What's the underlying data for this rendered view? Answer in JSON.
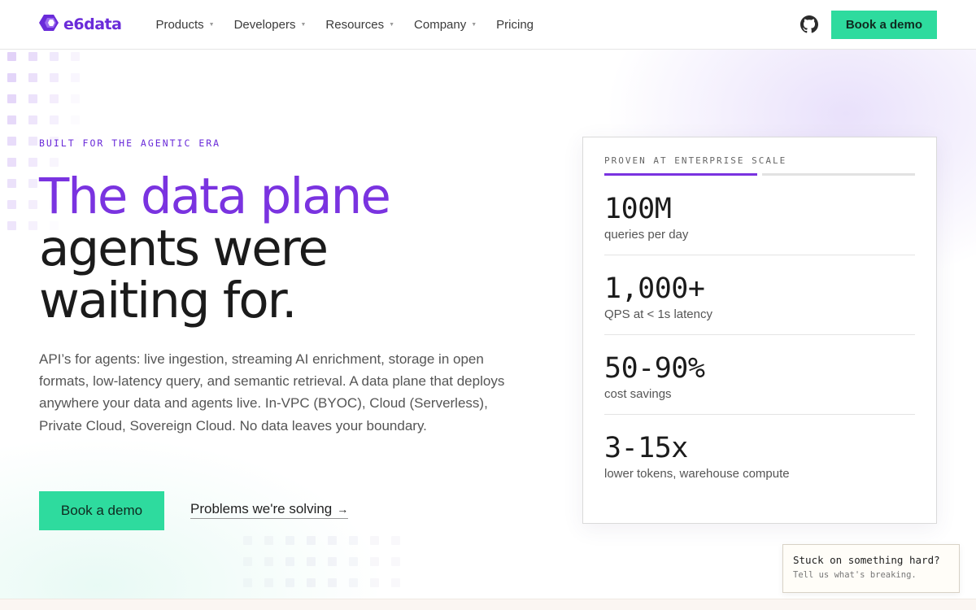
{
  "brand": {
    "name": "e6data",
    "accent": "#7a33e0",
    "cta_color": "#2edb9e"
  },
  "nav": {
    "items": [
      {
        "label": "Products",
        "has_dropdown": true
      },
      {
        "label": "Developers",
        "has_dropdown": true
      },
      {
        "label": "Resources",
        "has_dropdown": true
      },
      {
        "label": "Company",
        "has_dropdown": true
      },
      {
        "label": "Pricing",
        "has_dropdown": false
      }
    ],
    "github_icon": "github-icon",
    "cta_label": "Book a demo"
  },
  "hero": {
    "eyebrow": "BUILT FOR THE AGENTIC ERA",
    "headline_accent": "The data plane",
    "headline_line2": "agents were",
    "headline_line3": "waiting for.",
    "description": "API’s for agents: live ingestion, streaming AI enrichment, storage in open formats, low-latency query, and semantic retrieval. A data plane that deploys anywhere your data and agents live. In-VPC (BYOC), Cloud (Serverless), Private Cloud, Sovereign Cloud. No data leaves your boundary.",
    "primary_cta": "Book a demo",
    "secondary_cta": "Problems we're solving",
    "secondary_arrow": "→"
  },
  "stats": {
    "label": "PROVEN AT ENTERPRISE SCALE",
    "progress_active_segment": 1,
    "progress_total_segments": 2,
    "items": [
      {
        "value": "100M",
        "label": "queries per day"
      },
      {
        "value": "1,000+",
        "label": "QPS at < 1s latency"
      },
      {
        "value": "50-90%",
        "label": "cost savings"
      },
      {
        "value": "3-15x",
        "label": "lower tokens, warehouse compute"
      }
    ]
  },
  "help_widget": {
    "title": "Stuck on something hard?",
    "subtitle": "Tell us what's breaking."
  }
}
